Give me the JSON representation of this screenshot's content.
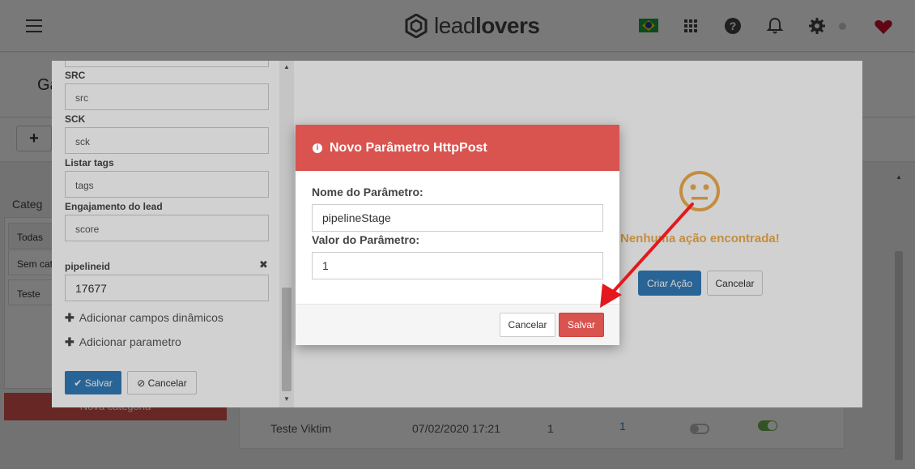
{
  "app": {
    "logo_light": "lead",
    "logo_bold": "lovers"
  },
  "background": {
    "page_title": "Ga",
    "plus_label": "+",
    "categories_title": "Categ",
    "categories": [
      "Todas",
      "Sem cat",
      "Teste"
    ],
    "new_category_label": "Nova categoria",
    "row": {
      "name": "Teste Viktim",
      "date": "07/02/2020 17:21",
      "count1": "1",
      "count2": "1"
    }
  },
  "middle_modal": {
    "empty_text": "Nenhuma ação encontrada!",
    "create_action_label": "Criar Ação",
    "cancel_label": "Cancelar"
  },
  "side_form": {
    "fields": [
      {
        "label": "SRC",
        "value": "src"
      },
      {
        "label": "SCK",
        "value": "sck"
      },
      {
        "label": "Listar tags",
        "value": "tags"
      },
      {
        "label": "Engajamento do lead",
        "value": "score"
      }
    ],
    "custom_param": {
      "label": "pipelineid",
      "value": "17677"
    },
    "add_dynamic_fields": "Adicionar campos dinâmicos",
    "add_parameter": "Adicionar parametro",
    "save_label": "Salvar",
    "cancel_label": "Cancelar"
  },
  "modal": {
    "title": "Novo Parâmetro HttpPost",
    "name_label": "Nome do Parâmetro:",
    "name_value": "pipelineStage",
    "value_label": "Valor do Parâmetro:",
    "value_value": "1",
    "cancel_label": "Cancelar",
    "save_label": "Salvar"
  },
  "colors": {
    "accent_red": "#d9534f",
    "primary_blue": "#337ab7",
    "warning_orange": "#f0ad4e",
    "toggle_green": "#6ab04c",
    "heart_red": "#c8102e"
  },
  "icons": [
    "menu-icon",
    "logo-icon",
    "brazil-flag-icon",
    "apps-grid-icon",
    "help-icon",
    "bell-icon",
    "gear-icon",
    "heart-icon",
    "info-icon",
    "check-icon",
    "ban-icon",
    "plus-icon",
    "close-icon",
    "sad-face-icon",
    "annotation-arrow"
  ]
}
